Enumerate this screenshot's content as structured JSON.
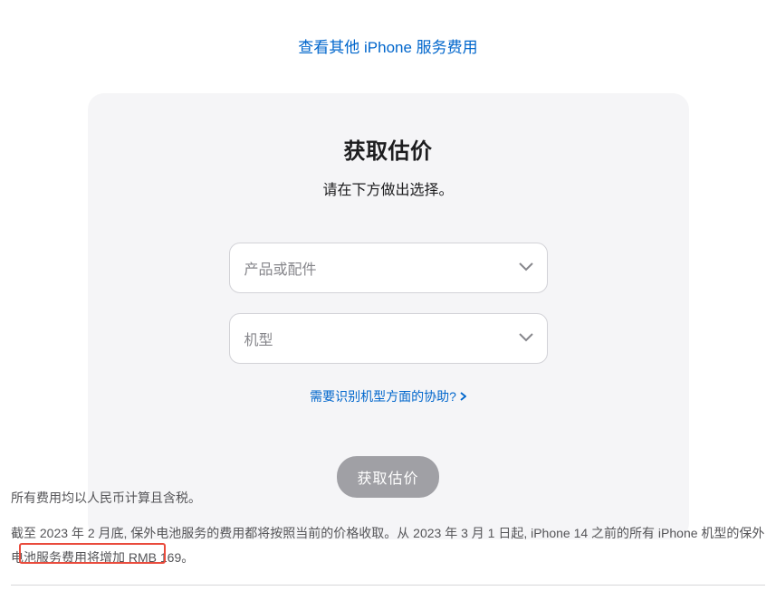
{
  "top_link": "查看其他 iPhone 服务费用",
  "card": {
    "title": "获取估价",
    "subtitle": "请在下方做出选择。",
    "select_product_placeholder": "产品或配件",
    "select_model_placeholder": "机型",
    "help_link": "需要识别机型方面的协助?",
    "submit_label": "获取估价"
  },
  "footer": {
    "line1": "所有费用均以人民币计算且含税。",
    "line2": "截至 2023 年 2 月底, 保外电池服务的费用都将按照当前的价格收取。从 2023 年 3 月 1 日起, iPhone 14 之前的所有 iPhone 机型的保外电池服务费用将增加 RMB 169。"
  }
}
